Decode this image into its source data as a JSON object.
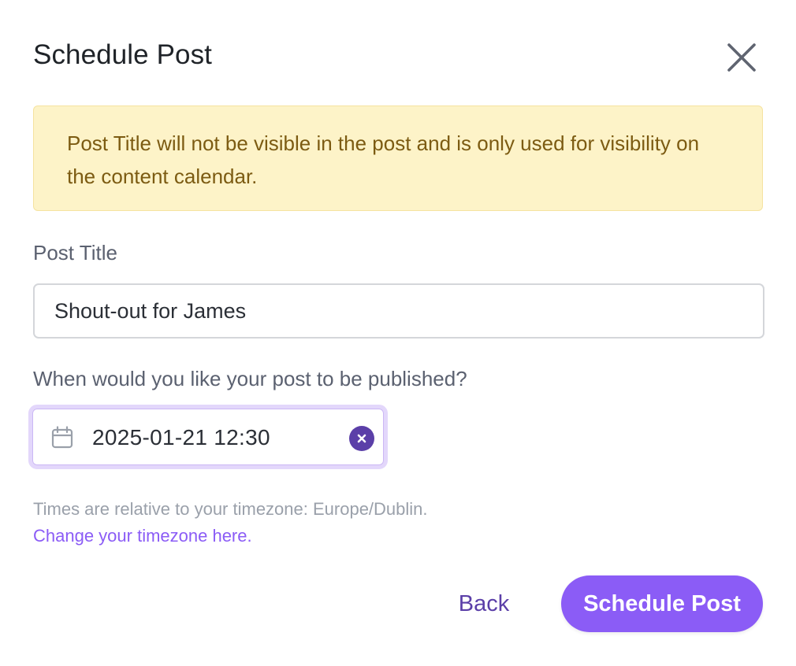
{
  "dialog": {
    "title": "Schedule Post",
    "close_icon": "close-icon"
  },
  "notice": {
    "text": "Post Title will not be visible in the post and is only used for visibility on the content calendar.",
    "color": "#fdf3c8"
  },
  "form": {
    "title_label": "Post Title",
    "title_value": "Shout-out for James",
    "when_label": "When would you like your post to be published?",
    "datetime_value": "2025-01-21 12:30",
    "calendar_icon": "calendar-icon",
    "clear_icon": "clear-icon",
    "timezone_hint": "Times are relative to your timezone: Europe/Dublin.",
    "timezone_link": "Change your timezone here."
  },
  "actions": {
    "back_label": "Back",
    "submit_label": "Schedule Post"
  },
  "colors": {
    "accent": "#8b5cf6",
    "accent_dark": "#5b3fa8",
    "notice_text": "#7c5b12"
  }
}
